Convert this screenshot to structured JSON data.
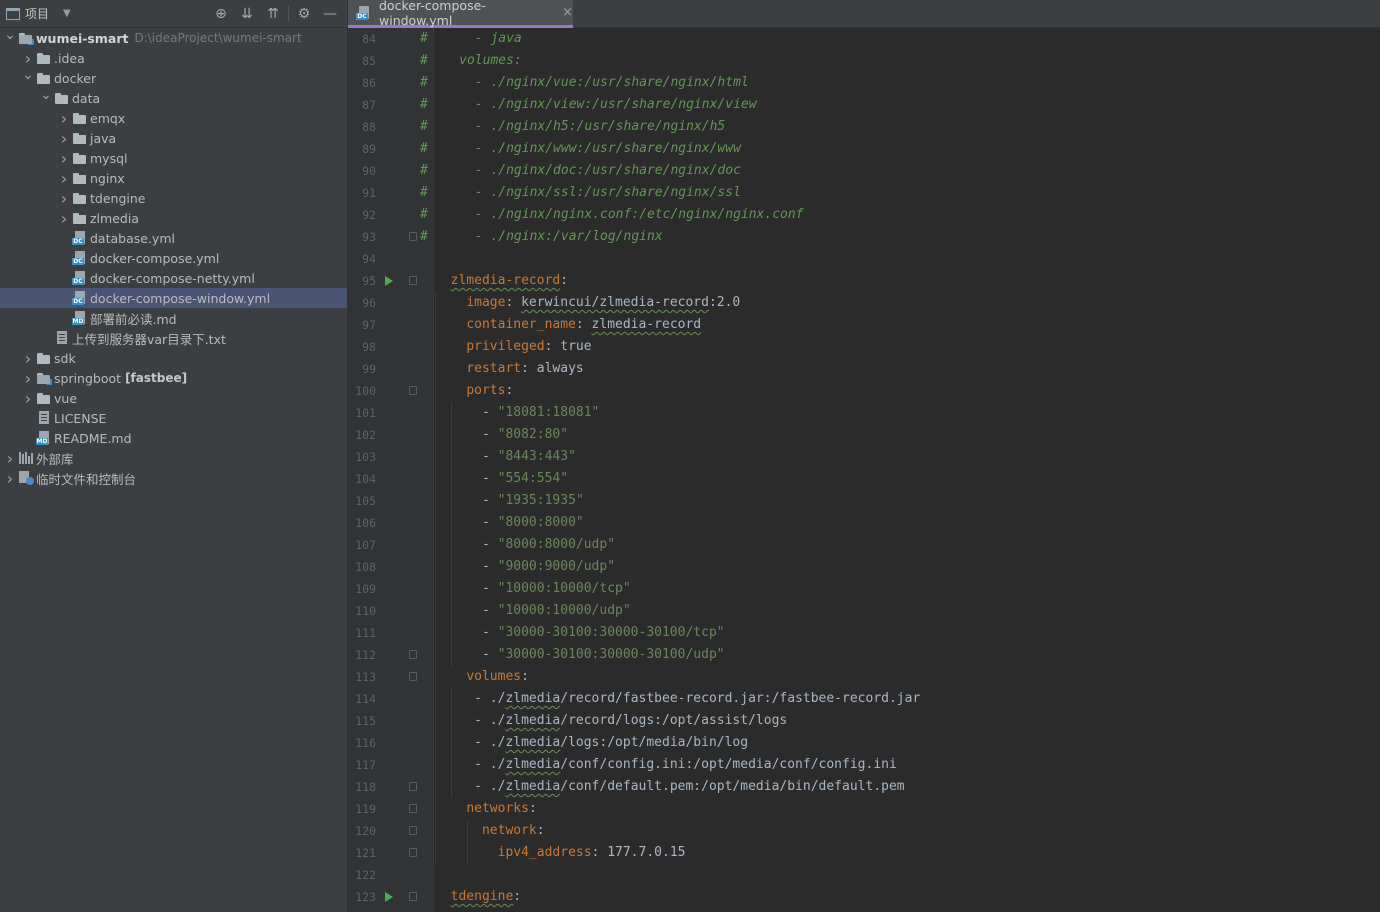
{
  "project_panel": {
    "title": "项目",
    "tree": [
      {
        "label": "wumei-smart",
        "path": "D:\\ideaProject\\wumei-smart",
        "depth": 0,
        "expanded": true,
        "icon": "module-folder-icon",
        "bold": true
      },
      {
        "label": ".idea",
        "depth": 1,
        "expanded": false,
        "icon": "folder-icon"
      },
      {
        "label": "docker",
        "depth": 1,
        "expanded": true,
        "icon": "folder-icon"
      },
      {
        "label": "data",
        "depth": 2,
        "expanded": true,
        "icon": "folder-icon"
      },
      {
        "label": "emqx",
        "depth": 3,
        "expanded": false,
        "icon": "folder-icon"
      },
      {
        "label": "java",
        "depth": 3,
        "expanded": false,
        "icon": "folder-icon"
      },
      {
        "label": "mysql",
        "depth": 3,
        "expanded": false,
        "icon": "folder-icon"
      },
      {
        "label": "nginx",
        "depth": 3,
        "expanded": false,
        "icon": "folder-icon"
      },
      {
        "label": "tdengine",
        "depth": 3,
        "expanded": false,
        "icon": "folder-icon"
      },
      {
        "label": "zlmedia",
        "depth": 3,
        "expanded": false,
        "icon": "folder-icon"
      },
      {
        "label": "database.yml",
        "depth": 3,
        "icon": "yml-file-icon"
      },
      {
        "label": "docker-compose.yml",
        "depth": 3,
        "icon": "yml-file-icon"
      },
      {
        "label": "docker-compose-netty.yml",
        "depth": 3,
        "icon": "yml-file-icon"
      },
      {
        "label": "docker-compose-window.yml",
        "depth": 3,
        "icon": "yml-file-icon",
        "selected": true
      },
      {
        "label": "部署前必读.md",
        "depth": 3,
        "icon": "md-file-icon"
      },
      {
        "label": "上传到服务器var目录下.txt",
        "depth": 2,
        "icon": "txt-file-icon"
      },
      {
        "label": "sdk",
        "depth": 1,
        "expanded": false,
        "icon": "folder-icon"
      },
      {
        "label": "springboot",
        "badge": "[fastbee]",
        "depth": 1,
        "expanded": false,
        "icon": "module-folder-icon"
      },
      {
        "label": "vue",
        "depth": 1,
        "expanded": false,
        "icon": "folder-icon"
      },
      {
        "label": "LICENSE",
        "depth": 1,
        "icon": "txt-file-icon"
      },
      {
        "label": "README.md",
        "depth": 1,
        "icon": "md-file-icon"
      },
      {
        "label": "外部库",
        "depth": 0,
        "expanded": false,
        "icon": "library-icon"
      },
      {
        "label": "临时文件和控制台",
        "depth": 0,
        "expanded": false,
        "icon": "scratch-icon"
      }
    ]
  },
  "editor": {
    "tab_label": "docker-compose-window.yml",
    "tab_close": "×",
    "lines": [
      {
        "n": "84",
        "text": "#      - java",
        "kind": "comment"
      },
      {
        "n": "85",
        "text": "#    volumes:",
        "kind": "comment"
      },
      {
        "n": "86",
        "text": "#      - ./nginx/vue:/usr/share/nginx/html",
        "kind": "comment"
      },
      {
        "n": "87",
        "text": "#      - ./nginx/view:/usr/share/nginx/view",
        "kind": "comment"
      },
      {
        "n": "88",
        "text": "#      - ./nginx/h5:/usr/share/nginx/h5",
        "kind": "comment"
      },
      {
        "n": "89",
        "text": "#      - ./nginx/www:/usr/share/nginx/www",
        "kind": "comment"
      },
      {
        "n": "90",
        "text": "#      - ./nginx/doc:/usr/share/nginx/doc",
        "kind": "comment"
      },
      {
        "n": "91",
        "text": "#      - ./nginx/ssl:/usr/share/nginx/ssl",
        "kind": "comment"
      },
      {
        "n": "92",
        "text": "#      - ./nginx/nginx.conf:/etc/nginx/nginx.conf",
        "kind": "comment"
      },
      {
        "n": "93",
        "text": "#      - ./nginx:/var/log/nginx",
        "kind": "comment",
        "fold": true
      },
      {
        "n": "94",
        "text": "",
        "kind": "blank"
      },
      {
        "n": "95",
        "indent": "  ",
        "key": "zlmedia-record",
        "value": "",
        "kind": "kv",
        "run": true,
        "fold": true,
        "squig_key": true
      },
      {
        "n": "96",
        "indent": "    ",
        "key": "image",
        "value": "kerwincui/zlmedia-record:2.0",
        "kind": "kv",
        "squig_val": "kerwincui/zlmedia-record"
      },
      {
        "n": "97",
        "indent": "    ",
        "key": "container_name",
        "value": "zlmedia-record",
        "kind": "kv",
        "squig_val": "zlmedia-record"
      },
      {
        "n": "98",
        "indent": "    ",
        "key": "privileged",
        "value": "true",
        "kind": "kv"
      },
      {
        "n": "99",
        "indent": "    ",
        "key": "restart",
        "value": "always",
        "kind": "kv"
      },
      {
        "n": "100",
        "indent": "    ",
        "key": "ports",
        "value": "",
        "kind": "kv",
        "fold": true
      },
      {
        "n": "101",
        "indent": "      - ",
        "value": "\"18081:18081\"",
        "kind": "item-str"
      },
      {
        "n": "102",
        "indent": "      - ",
        "value": "\"8082:80\"",
        "kind": "item-str"
      },
      {
        "n": "103",
        "indent": "      - ",
        "value": "\"8443:443\"",
        "kind": "item-str"
      },
      {
        "n": "104",
        "indent": "      - ",
        "value": "\"554:554\"",
        "kind": "item-str"
      },
      {
        "n": "105",
        "indent": "      - ",
        "value": "\"1935:1935\"",
        "kind": "item-str"
      },
      {
        "n": "106",
        "indent": "      - ",
        "value": "\"8000:8000\"",
        "kind": "item-str"
      },
      {
        "n": "107",
        "indent": "      - ",
        "value": "\"8000:8000/udp\"",
        "kind": "item-str"
      },
      {
        "n": "108",
        "indent": "      - ",
        "value": "\"9000:9000/udp\"",
        "kind": "item-str"
      },
      {
        "n": "109",
        "indent": "      - ",
        "value": "\"10000:10000/tcp\"",
        "kind": "item-str"
      },
      {
        "n": "110",
        "indent": "      - ",
        "value": "\"10000:10000/udp\"",
        "kind": "item-str"
      },
      {
        "n": "111",
        "indent": "      - ",
        "value": "\"30000-30100:30000-30100/tcp\"",
        "kind": "item-str"
      },
      {
        "n": "112",
        "indent": "      - ",
        "value": "\"30000-30100:30000-30100/udp\"",
        "kind": "item-str",
        "fold": true
      },
      {
        "n": "113",
        "indent": "    ",
        "key": "volumes",
        "value": "",
        "kind": "kv",
        "fold": true
      },
      {
        "n": "114",
        "indent": "     - ",
        "value": "./zlmedia/record/fastbee-record.jar:/fastbee-record.jar",
        "kind": "item-plain",
        "squig_val": "zlmedia"
      },
      {
        "n": "115",
        "indent": "     - ",
        "value": "./zlmedia/record/logs:/opt/assist/logs",
        "kind": "item-plain",
        "squig_val": "zlmedia"
      },
      {
        "n": "116",
        "indent": "     - ",
        "value": "./zlmedia/logs:/opt/media/bin/log",
        "kind": "item-plain",
        "squig_val": "zlmedia"
      },
      {
        "n": "117",
        "indent": "     - ",
        "value": "./zlmedia/conf/config.ini:/opt/media/conf/config.ini",
        "kind": "item-plain",
        "squig_val": "zlmedia"
      },
      {
        "n": "118",
        "indent": "     - ",
        "value": "./zlmedia/conf/default.pem:/opt/media/bin/default.pem",
        "kind": "item-plain",
        "squig_val": "zlmedia",
        "fold": true
      },
      {
        "n": "119",
        "indent": "    ",
        "key": "networks",
        "value": "",
        "kind": "kv",
        "fold": true
      },
      {
        "n": "120",
        "indent": "      ",
        "key": "network",
        "value": "",
        "kind": "kv",
        "fold": true
      },
      {
        "n": "121",
        "indent": "        ",
        "key": "ipv4_address",
        "value": "177.7.0.15",
        "kind": "kv",
        "fold": true
      },
      {
        "n": "122",
        "text": "",
        "kind": "blank"
      },
      {
        "n": "123",
        "indent": "  ",
        "key": "tdengine",
        "value": "",
        "kind": "kv",
        "run": true,
        "fold": true,
        "squig_key": true
      }
    ]
  }
}
